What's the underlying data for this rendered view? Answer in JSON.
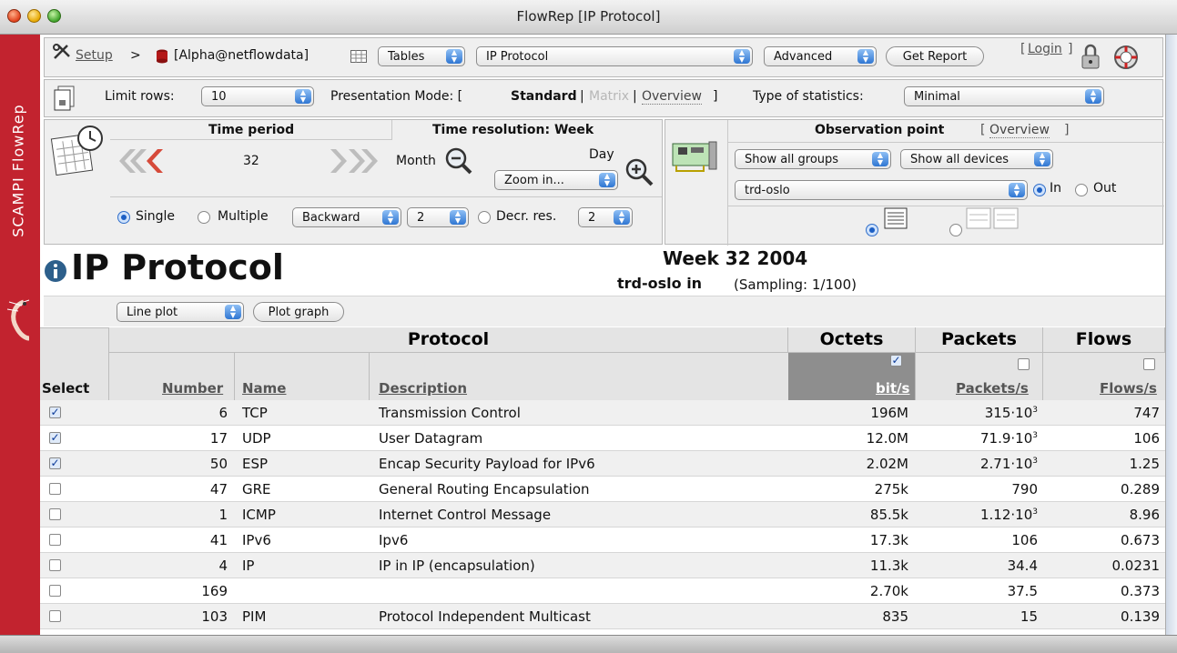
{
  "window": {
    "title": "FlowRep [IP Protocol]"
  },
  "sidebar": {
    "brand": "SCAMPI FlowRep"
  },
  "toolbar": {
    "setup": "Setup",
    "sep": ">",
    "database": "[Alpha@netflowdata]",
    "tables": "Tables",
    "table_select": "IP Protocol",
    "advanced": "Advanced",
    "get_report": "Get Report",
    "login_open": "[",
    "login": "Login",
    "login_close": "]"
  },
  "options": {
    "limit_label": "Limit rows:",
    "limit_value": "10",
    "presentation_label": "Presentation Mode: [",
    "mode_standard": "Standard",
    "sep1": "|",
    "mode_matrix": "Matrix",
    "sep2": "|",
    "mode_overview": "Overview",
    "close": "]",
    "stats_label": "Type of statistics:",
    "stats_value": "Minimal"
  },
  "time": {
    "period_label": "Time period",
    "resolution_label": "Time resolution: Week",
    "period_value": "32",
    "month": "Month",
    "day": "Day",
    "zoom": "Zoom in...",
    "single": "Single",
    "multiple": "Multiple",
    "direction": "Backward",
    "count": "2",
    "decr": "Decr. res.",
    "decr_value": "2"
  },
  "observation": {
    "label": "Observation point",
    "overview_open": "[",
    "overview": "Overview",
    "overview_close": "]",
    "groups": "Show all groups",
    "devices": "Show all devices",
    "device": "trd-oslo",
    "in": "In",
    "out": "Out"
  },
  "report": {
    "title": "IP Protocol",
    "week": "Week 32 2004",
    "device": "trd-oslo in",
    "sampling": "(Sampling: 1/100)",
    "plot_type": "Line plot",
    "plot_button": "Plot graph"
  },
  "table": {
    "group_protocol": "Protocol",
    "group_octets": "Octets",
    "group_packets": "Packets",
    "group_flows": "Flows",
    "col_select": "Select",
    "col_number": "Number",
    "col_name": "Name",
    "col_description": "Description",
    "col_bits": "bit/s",
    "col_packets": "Packets/s",
    "col_flows": "Flows/s",
    "rows": [
      {
        "checked": true,
        "number": "6",
        "name": "TCP",
        "description": "Transmission Control",
        "bits": "196M",
        "pkt_base": "315·10",
        "pkt_exp": "3",
        "flows": "747"
      },
      {
        "checked": true,
        "number": "17",
        "name": "UDP",
        "description": "User Datagram",
        "bits": "12.0M",
        "pkt_base": "71.9·10",
        "pkt_exp": "3",
        "flows": "106"
      },
      {
        "checked": true,
        "number": "50",
        "name": "ESP",
        "description": "Encap Security Payload for IPv6",
        "bits": "2.02M",
        "pkt_base": "2.71·10",
        "pkt_exp": "3",
        "flows": "1.25"
      },
      {
        "checked": false,
        "number": "47",
        "name": "GRE",
        "description": "General Routing Encapsulation",
        "bits": "275k",
        "pkt_base": "790",
        "pkt_exp": "",
        "flows": "0.289"
      },
      {
        "checked": false,
        "number": "1",
        "name": "ICMP",
        "description": "Internet Control Message",
        "bits": "85.5k",
        "pkt_base": "1.12·10",
        "pkt_exp": "3",
        "flows": "8.96"
      },
      {
        "checked": false,
        "number": "41",
        "name": "IPv6",
        "description": "Ipv6",
        "bits": "17.3k",
        "pkt_base": "106",
        "pkt_exp": "",
        "flows": "0.673"
      },
      {
        "checked": false,
        "number": "4",
        "name": "IP",
        "description": "IP in IP (encapsulation)",
        "bits": "11.3k",
        "pkt_base": "34.4",
        "pkt_exp": "",
        "flows": "0.0231"
      },
      {
        "checked": false,
        "number": "169",
        "name": "",
        "description": "",
        "bits": "2.70k",
        "pkt_base": "37.5",
        "pkt_exp": "",
        "flows": "0.373"
      },
      {
        "checked": false,
        "number": "103",
        "name": "PIM",
        "description": "Protocol Independent Multicast",
        "bits": "835",
        "pkt_base": "15",
        "pkt_exp": "",
        "flows": "0.139"
      }
    ]
  },
  "colors": {
    "brand_red": "#c2232f",
    "sort_header": "#8e8e8e",
    "check_blue": "#1c5fc4"
  }
}
